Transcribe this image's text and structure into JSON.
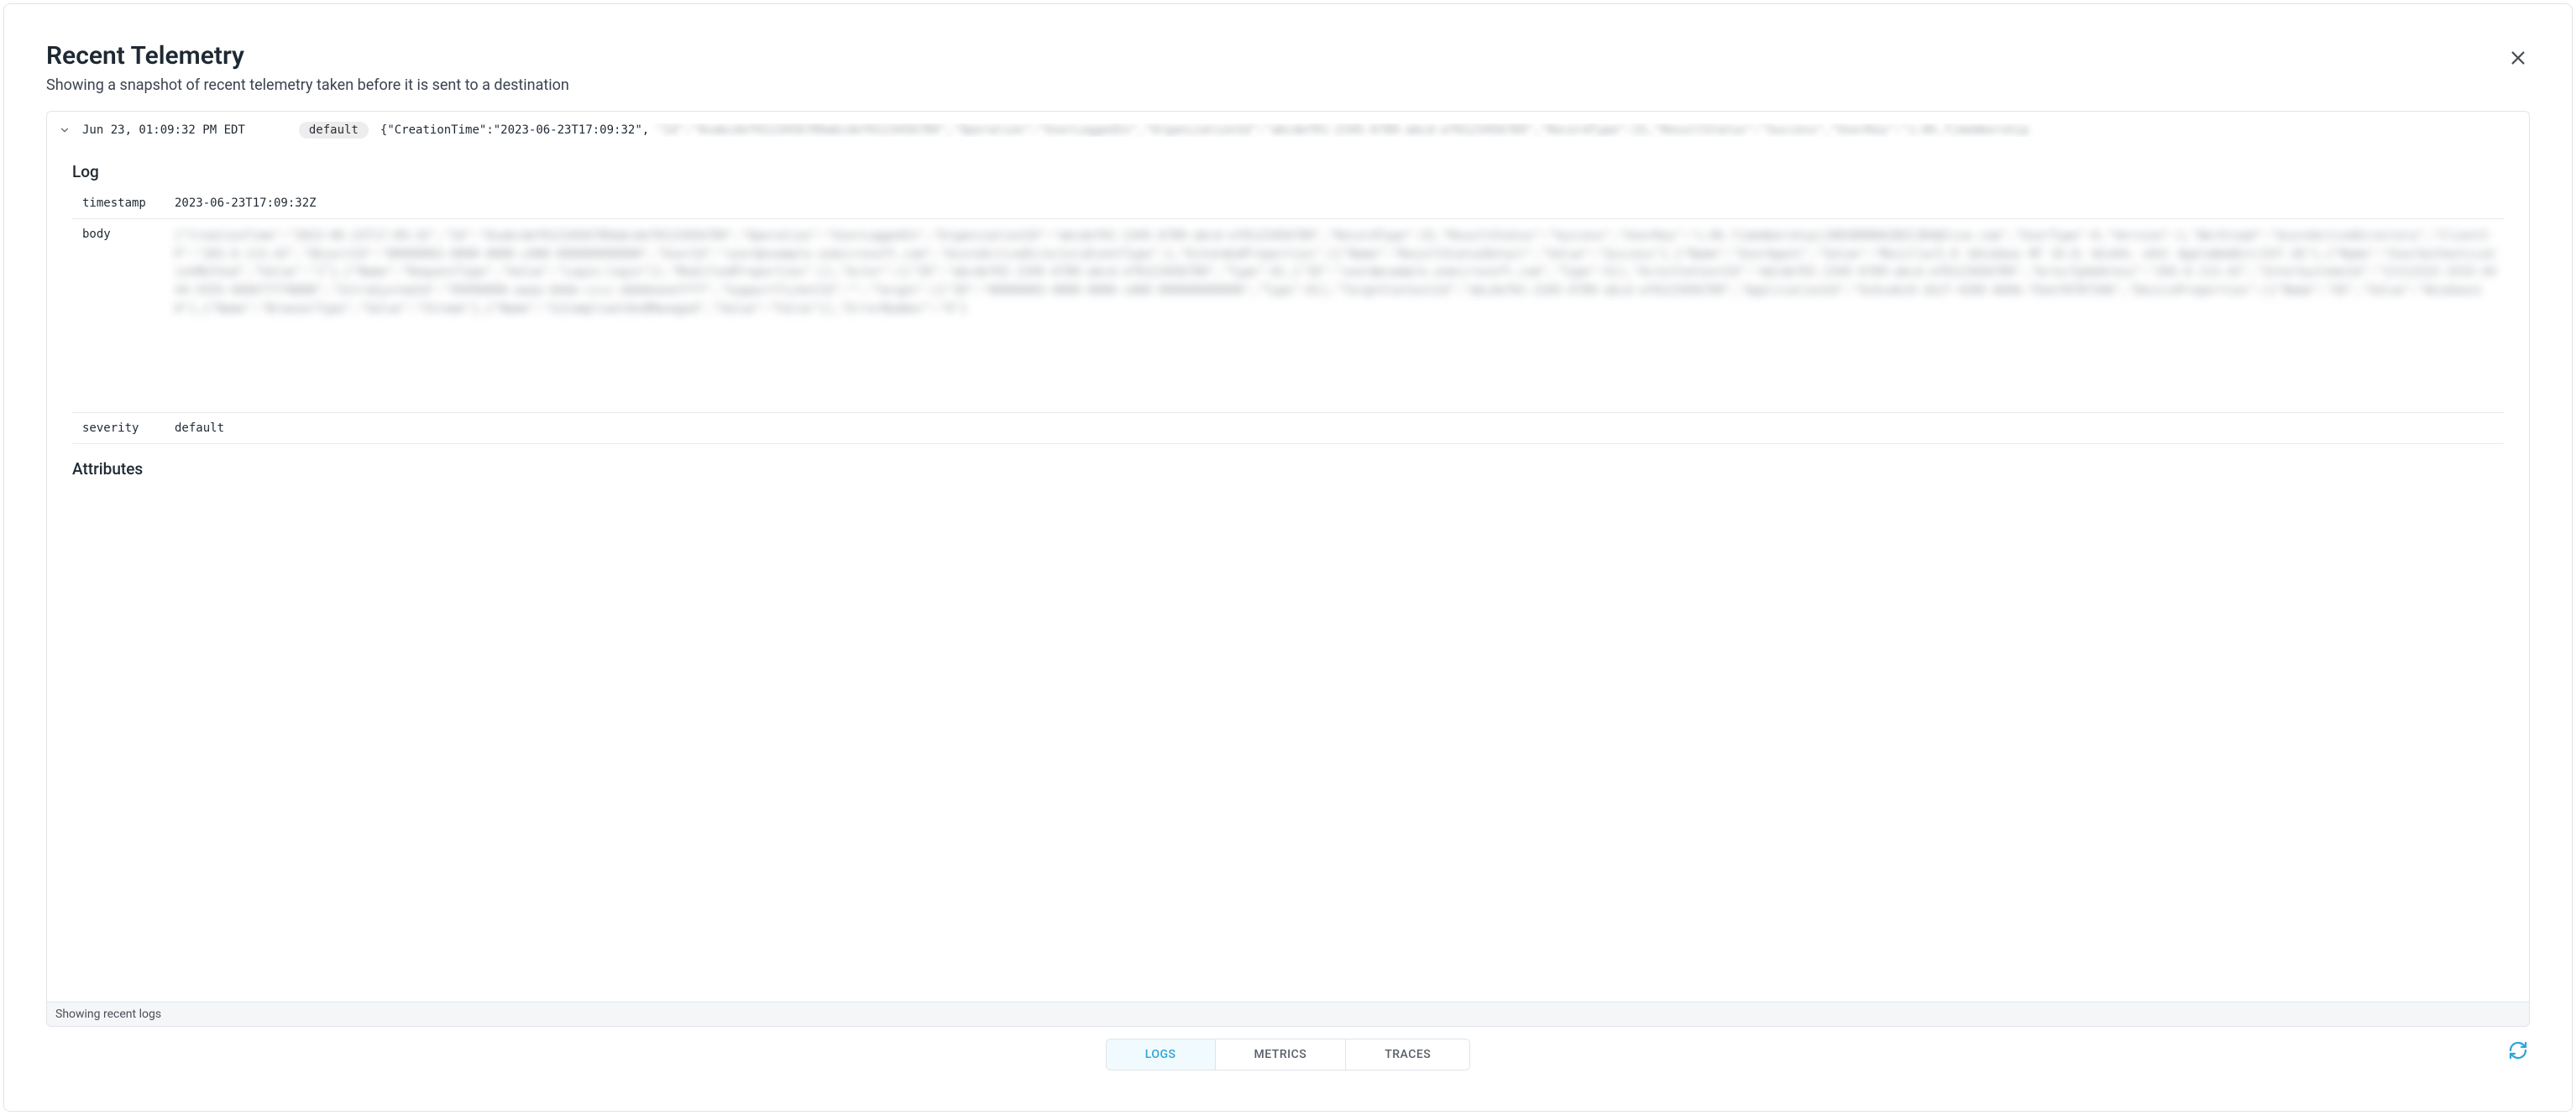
{
  "header": {
    "title": "Recent Telemetry",
    "subtitle": "Showing a snapshot of recent telemetry taken before it is sent to a destination"
  },
  "entry": {
    "timestamp_display": "Jun 23, 01:09:32 PM EDT",
    "badge": "default",
    "preview_visible": "{\"CreationTime\":\"2023-06-23T17:09:32\","
  },
  "log": {
    "section_label": "Log",
    "fields": {
      "timestamp_key": "timestamp",
      "timestamp_value": "2023-06-23T17:09:32Z",
      "body_key": "body",
      "severity_key": "severity",
      "severity_value": "default"
    }
  },
  "attributes": {
    "section_label": "Attributes"
  },
  "status_bar": {
    "text": "Showing recent logs"
  },
  "tabs": {
    "logs": "LOGS",
    "metrics": "METRICS",
    "traces": "TRACES"
  }
}
